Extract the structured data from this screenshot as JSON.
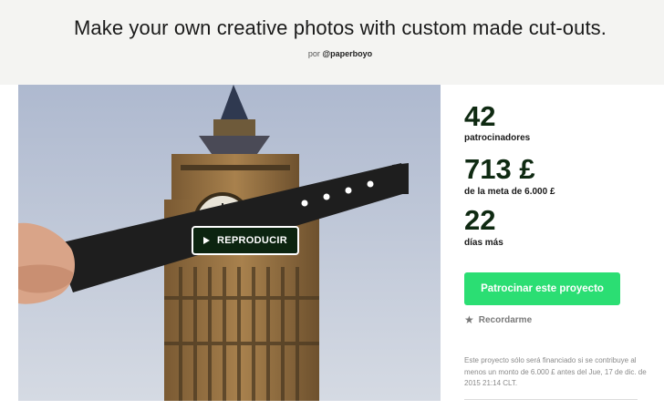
{
  "header": {
    "title": "Make your own creative photos with custom made cut-outs.",
    "byline_prefix": "por",
    "byline_author": "@paperboyo"
  },
  "video": {
    "play_label": "REPRODUCIR",
    "play_icon": "play-triangle-icon"
  },
  "stats": {
    "backers_count": "42",
    "backers_label": "patrocinadores",
    "pledged_amount": "713 £",
    "pledged_label": "de la meta de 6.000 £",
    "days_count": "22",
    "days_label": "días más"
  },
  "actions": {
    "back_label": "Patrocinar este proyecto",
    "remind_label": "Recordarme",
    "remind_icon": "star-icon"
  },
  "funding_note": "Este proyecto sólo será financiado si se contribuye al menos un monto de 6.000 £ antes del Jue, 17 de dic. de 2015 21:14 CLT.",
  "colors": {
    "accent_green": "#2bde73",
    "dark_green": "#0f2a12",
    "header_bg": "#f4f4f2"
  }
}
